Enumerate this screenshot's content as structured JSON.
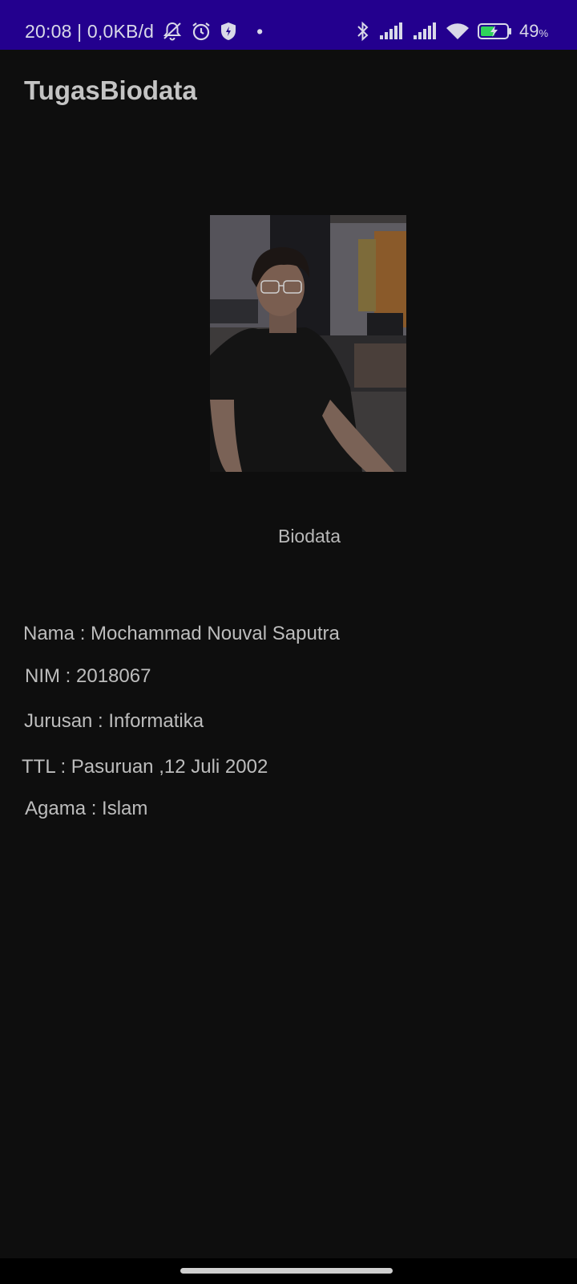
{
  "status_bar": {
    "time_and_speed": "20:08 | 0,0KB/d",
    "dot": "•",
    "battery_percent": "49",
    "battery_unit": "%",
    "icons": [
      "mute-bell-icon",
      "alarm-icon",
      "shield-icon",
      "bluetooth-icon",
      "signal-icon",
      "signal-icon",
      "wifi-icon",
      "battery-charging-icon"
    ],
    "background_color": "#23008e"
  },
  "app_bar": {
    "title": "TugasBiodata"
  },
  "main": {
    "heading": "Biodata",
    "fields": [
      {
        "text": "Nama : Mochammad Nouval Saputra"
      },
      {
        "text": "NIM : 2018067"
      },
      {
        "text": "Jurusan : Informatika"
      },
      {
        "text": "TTL : Pasuruan ,12 Juli 2002"
      },
      {
        "text": "Agama : Islam"
      }
    ]
  }
}
